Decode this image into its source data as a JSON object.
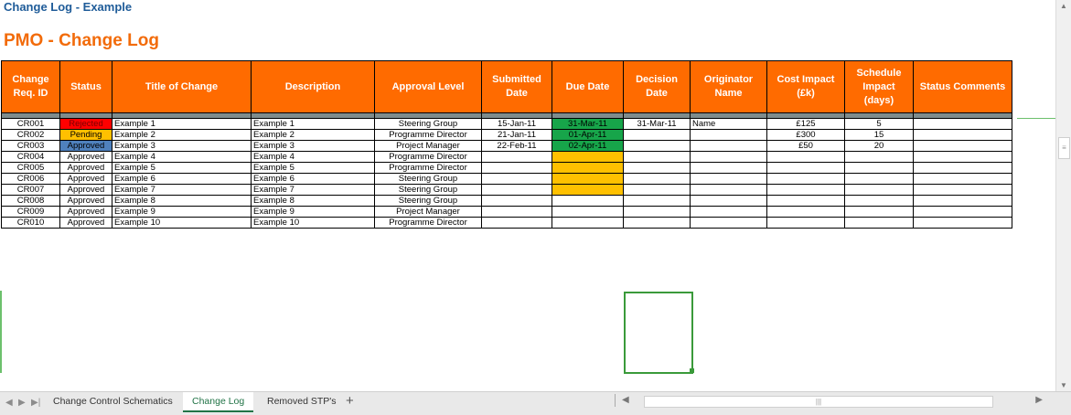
{
  "doc_title": "Change Log - Example",
  "log_title": "PMO - Change Log",
  "columns": [
    "Change Req. ID",
    "Status",
    "Title of Change",
    "Description",
    "Approval Level",
    "Submitted Date",
    "Due Date",
    "Decision Date",
    "Originator Name",
    "Cost Impact (£k)",
    "Schedule Impact (days)",
    "Status Comments"
  ],
  "rows": [
    {
      "id": "CR001",
      "status": "Rejected",
      "title": "Example 1",
      "description": "Example 1",
      "approval": "Steering Group",
      "submitted": "15-Jan-11",
      "due": "31-Mar-11",
      "decision": "31-Mar-11",
      "originator": "Name",
      "cost": "£125",
      "schedule": "5",
      "comments": ""
    },
    {
      "id": "CR002",
      "status": "Pending",
      "title": "Example 2",
      "description": "Example 2",
      "approval": "Programme Director",
      "submitted": "21-Jan-11",
      "due": "01-Apr-11",
      "decision": "",
      "originator": "",
      "cost": "£300",
      "schedule": "15",
      "comments": ""
    },
    {
      "id": "CR003",
      "status": "Approved",
      "title": "Example 3",
      "description": "Example 3",
      "approval": "Project Manager",
      "submitted": "22-Feb-11",
      "due": "02-Apr-11",
      "decision": "",
      "originator": "",
      "cost": "£50",
      "schedule": "20",
      "comments": ""
    },
    {
      "id": "CR004",
      "status": "Approved",
      "title": "Example 4",
      "description": "Example 4",
      "approval": "Programme Director",
      "submitted": "",
      "due": "",
      "decision": "",
      "originator": "",
      "cost": "",
      "schedule": "",
      "comments": ""
    },
    {
      "id": "CR005",
      "status": "Approved",
      "title": "Example 5",
      "description": "Example 5",
      "approval": "Programme Director",
      "submitted": "",
      "due": "",
      "decision": "",
      "originator": "",
      "cost": "",
      "schedule": "",
      "comments": ""
    },
    {
      "id": "CR006",
      "status": "Approved",
      "title": "Example 6",
      "description": "Example 6",
      "approval": "Steering Group",
      "submitted": "",
      "due": "",
      "decision": "",
      "originator": "",
      "cost": "",
      "schedule": "",
      "comments": ""
    },
    {
      "id": "CR007",
      "status": "Approved",
      "title": "Example 7",
      "description": "Example 7",
      "approval": "Steering Group",
      "submitted": "",
      "due": "",
      "decision": "",
      "originator": "",
      "cost": "",
      "schedule": "",
      "comments": ""
    },
    {
      "id": "CR008",
      "status": "Approved",
      "title": "Example 8",
      "description": "Example 8",
      "approval": "Steering Group",
      "submitted": "",
      "due": "",
      "decision": "",
      "originator": "",
      "cost": "",
      "schedule": "",
      "comments": ""
    },
    {
      "id": "CR009",
      "status": "Approved",
      "title": "Example 9",
      "description": "Example 9",
      "approval": "Project Manager",
      "submitted": "",
      "due": "",
      "decision": "",
      "originator": "",
      "cost": "",
      "schedule": "",
      "comments": ""
    },
    {
      "id": "CR010",
      "status": "Approved",
      "title": "Example 10",
      "description": "Example 10",
      "approval": "Programme Director",
      "submitted": "",
      "due": "",
      "decision": "",
      "originator": "",
      "cost": "",
      "schedule": "",
      "comments": ""
    }
  ],
  "status_colors": {
    "Rejected": "#ff0000",
    "Pending": "#ffc000",
    "Approved": "#4f81bd"
  },
  "due_colors": {
    "set": "#17a54a",
    "empty": "#ffc000"
  },
  "sheet_tabs": [
    {
      "label": "Change Control Schematics",
      "active": false
    },
    {
      "label": "Change Log",
      "active": true
    },
    {
      "label": "Removed STP's",
      "active": false
    }
  ],
  "icons": {
    "add_sheet": "plus-icon",
    "tab_nav_prev": "caret-left-icon",
    "tab_nav_next": "caret-right-icon"
  }
}
